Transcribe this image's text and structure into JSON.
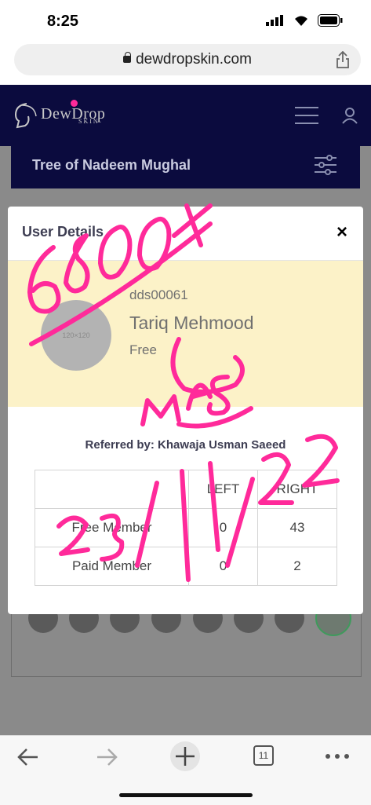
{
  "status_bar": {
    "time": "8:25"
  },
  "browser": {
    "url": "dewdropskin.com",
    "tab_count": "11"
  },
  "site": {
    "logo_text": "DewDrop",
    "logo_sub": "SKIN",
    "tree_title": "Tree of Nadeem Mughal"
  },
  "modal": {
    "title": "User Details",
    "close_label": "×",
    "avatar_placeholder": "120×120",
    "user_id": "dds00061",
    "user_name": "Tariq Mehmood",
    "user_status": "Free",
    "referred_by": "Referred by: Khawaja Usman Saeed",
    "table": {
      "headers": [
        "",
        "LEFT",
        "RIGHT"
      ],
      "rows": [
        {
          "label": "Free Member",
          "left": "0",
          "right": "43"
        },
        {
          "label": "Paid Member",
          "left": "0",
          "right": "2"
        }
      ]
    }
  },
  "annotation": {
    "amount": "6800+",
    "initials": "MAS",
    "date": "23/11/22",
    "color": "#ff2a9a"
  }
}
